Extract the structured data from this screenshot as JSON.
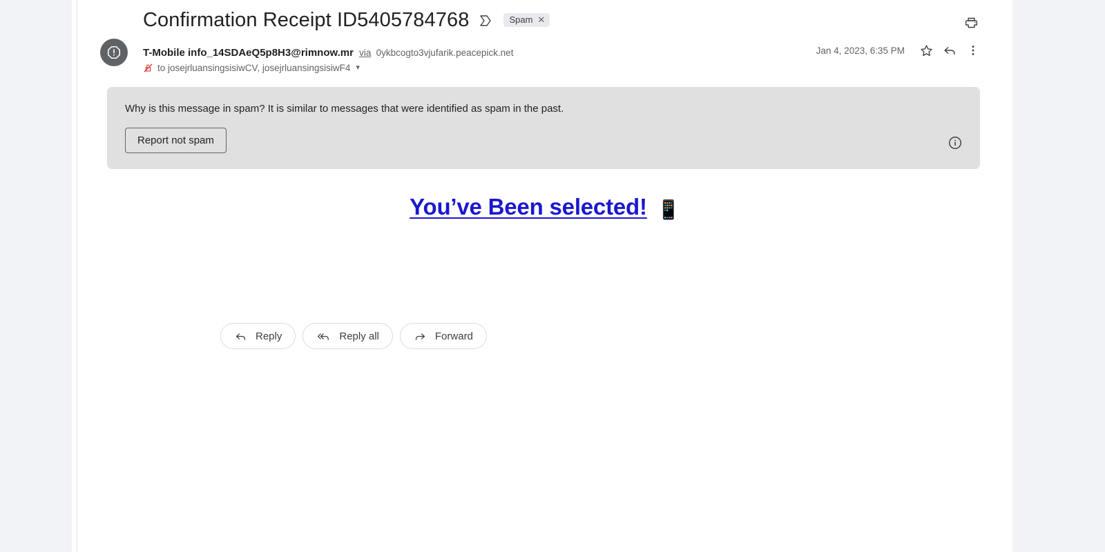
{
  "window": {
    "background_color": "#f1f3f6",
    "pane_color": "#ffffff"
  },
  "subject": {
    "title": "Confirmation Receipt ID5405784768",
    "inbox_icon": "inbox-icon",
    "label_chip": "Spam",
    "label_chip_remove": "✕",
    "print_icon": "print-icon"
  },
  "sender": {
    "avatar_icon": "warning-octagon-icon",
    "name": "T-Mobile",
    "email": "info_14SDAeQ5p8H3@rimnow.mr",
    "via_label": "via",
    "via_domain": "0ykbcogto3vjufarik.peacepick.net",
    "security_icon": "no-encryption-icon",
    "recipients": "to josejrluansingsisiwCV, josejrluansingsisiwF4",
    "recipients_caret": "▾",
    "date": "Jan 4, 2023, 6:35 PM",
    "star_icon": "star-icon",
    "reply_icon": "reply-icon",
    "more_icon": "more-vertical-icon"
  },
  "spam_banner": {
    "message": "Why is this message in spam? It is similar to messages that were identified as spam in the past.",
    "report_button": "Report not spam",
    "info_icon": "info-circle-icon",
    "background_color": "#e0e0e0"
  },
  "body": {
    "headline": "You’ve Been selected!",
    "headline_emoji": "📱",
    "headline_color": "#1a17cf"
  },
  "actions": {
    "reply": "Reply",
    "reply_all": "Reply all",
    "forward": "Forward"
  }
}
